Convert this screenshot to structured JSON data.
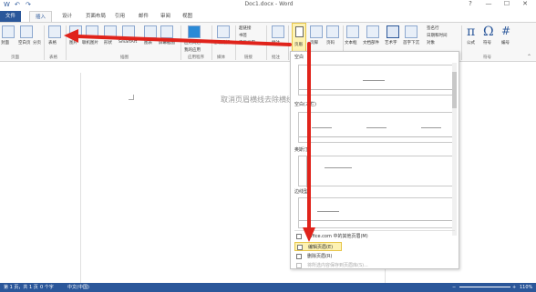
{
  "titlebar": {
    "title": "Doc1.docx - Word",
    "undo": "↶",
    "redo": "↷",
    "help": "?",
    "minimize": "—",
    "maximize": "☐",
    "close": "✕"
  },
  "tabs": [
    {
      "label": "文件"
    },
    {
      "label": "插入"
    },
    {
      "label": "设计"
    },
    {
      "label": "页面布局"
    },
    {
      "label": "引用"
    },
    {
      "label": "邮件"
    },
    {
      "label": "审阅"
    },
    {
      "label": "视图"
    }
  ],
  "ribbon": {
    "buttons": [
      {
        "label": "封面"
      },
      {
        "label": "空白页"
      },
      {
        "label": "分页"
      },
      {
        "label": "表格"
      },
      {
        "label": "图片"
      },
      {
        "label": "联机图片"
      },
      {
        "label": "形状"
      },
      {
        "label": "SmartArt"
      },
      {
        "label": "图表"
      },
      {
        "label": "屏幕截图"
      },
      {
        "label": "应用商店"
      },
      {
        "label": "我的应用"
      },
      {
        "label": "在线视频"
      },
      {
        "label": "超链接"
      },
      {
        "label": "书签"
      },
      {
        "label": "交叉引用"
      },
      {
        "label": "批注"
      },
      {
        "label": "页眉"
      },
      {
        "label": "页脚"
      },
      {
        "label": "页码"
      },
      {
        "label": "文本框"
      },
      {
        "label": "文档部件"
      },
      {
        "label": "艺术字"
      },
      {
        "label": "首字下沉"
      },
      {
        "label": "签名行"
      },
      {
        "label": "日期和时间"
      },
      {
        "label": "对象"
      },
      {
        "label": "公式"
      },
      {
        "label": "符号"
      },
      {
        "label": "编号"
      }
    ],
    "groups": [
      {
        "label": "页面"
      },
      {
        "label": "表格"
      },
      {
        "label": "插图"
      },
      {
        "label": "应用程序"
      },
      {
        "label": "媒体"
      },
      {
        "label": "链接"
      },
      {
        "label": "批注"
      },
      {
        "label": "符号"
      }
    ]
  },
  "document": {
    "text": "取消页眉横线去除横线"
  },
  "gallery": {
    "sections": [
      {
        "label": "空白"
      },
      {
        "label": "空白(三栏)"
      },
      {
        "label": "奥斯汀"
      },
      {
        "label": "边线型"
      }
    ],
    "menu": [
      {
        "label": "Office.com 中的其他页眉(M)",
        "state": "normal"
      },
      {
        "label": "编辑页眉(E)",
        "state": "highlight"
      },
      {
        "label": "删除页眉(R)",
        "state": "normal"
      },
      {
        "label": "将所选内容保存到页眉库(S)...",
        "state": "disabled"
      }
    ]
  },
  "status": {
    "page": "第 1 页，共 1 页",
    "words": "0 个字",
    "lang": "中文(中国)",
    "zoom": "110%"
  },
  "colors": {
    "accent": "#2b579a",
    "highlight": "#fdf2b3",
    "arrow": "#e0231b"
  }
}
